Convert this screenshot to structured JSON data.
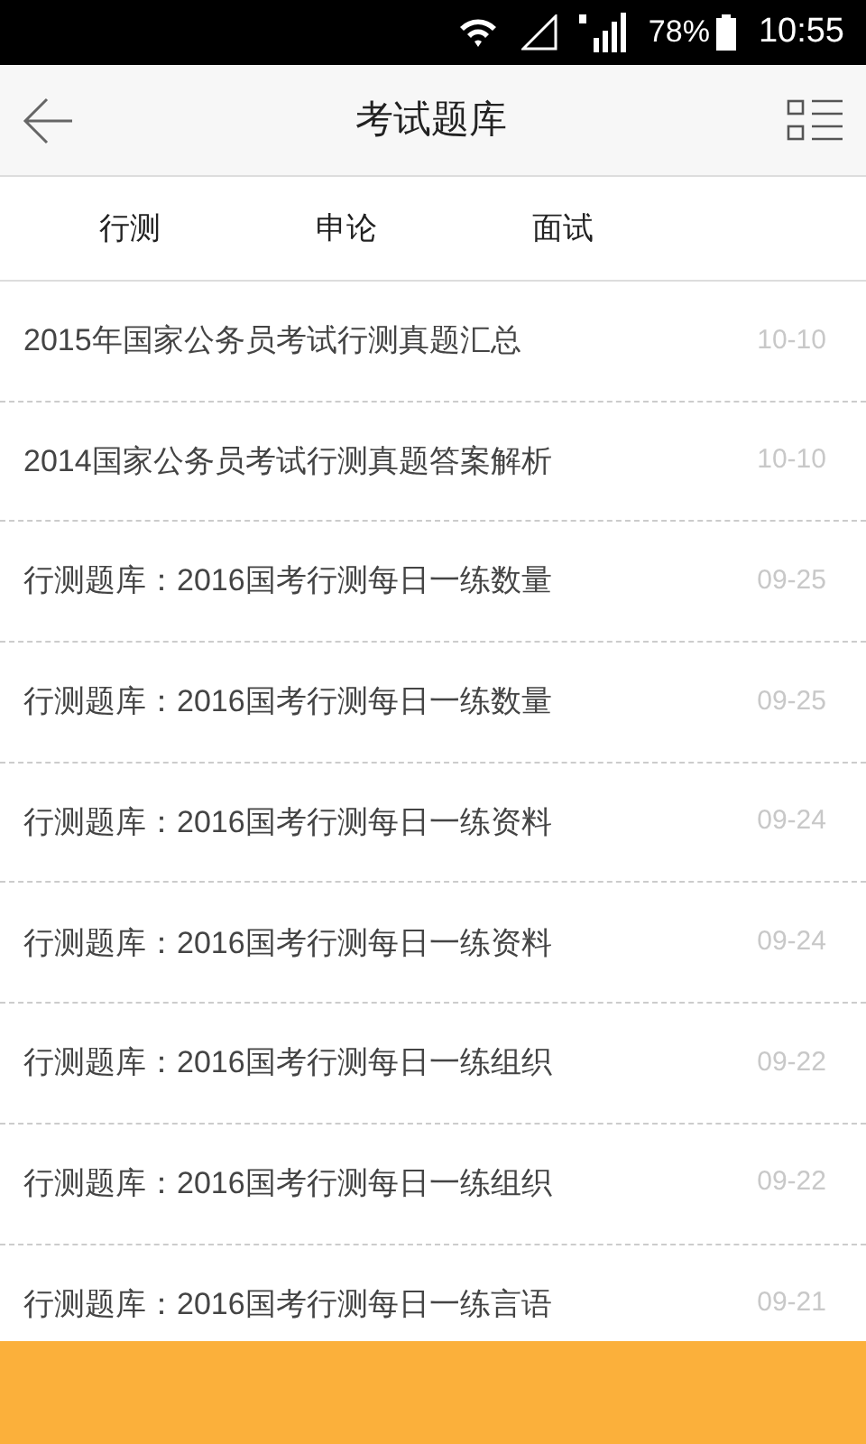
{
  "status_bar": {
    "battery": "78%",
    "time": "10:55"
  },
  "header": {
    "title": "考试题库"
  },
  "tabs": [
    {
      "label": "行测"
    },
    {
      "label": "申论"
    },
    {
      "label": "面试"
    }
  ],
  "articles": [
    {
      "title": "2015年国家公务员考试行测真题汇总",
      "date": "10-10"
    },
    {
      "title": "2014国家公务员考试行测真题答案解析",
      "date": "10-10"
    },
    {
      "title": "行测题库：2016国考行测每日一练数量",
      "date": "09-25"
    },
    {
      "title": "行测题库：2016国考行测每日一练数量",
      "date": "09-25"
    },
    {
      "title": "行测题库：2016国考行测每日一练资料",
      "date": "09-24"
    },
    {
      "title": "行测题库：2016国考行测每日一练资料",
      "date": "09-24"
    },
    {
      "title": "行测题库：2016国考行测每日一练组织",
      "date": "09-22"
    },
    {
      "title": "行测题库：2016国考行测每日一练组织",
      "date": "09-22"
    },
    {
      "title": "行测题库：2016国考行测每日一练言语",
      "date": "09-21"
    }
  ]
}
